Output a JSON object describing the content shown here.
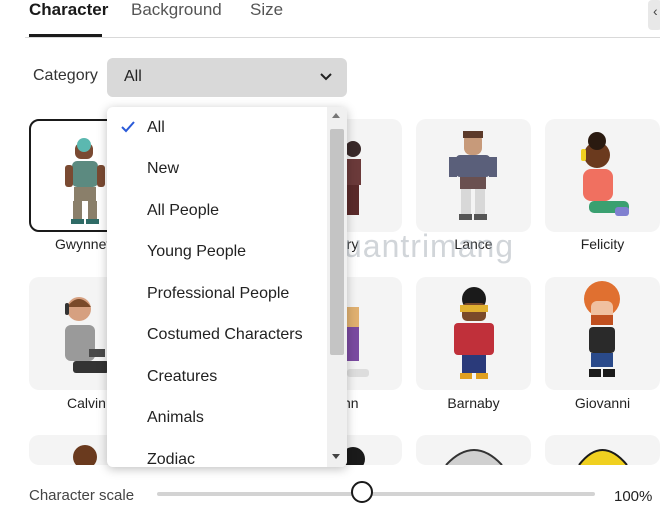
{
  "tabs": [
    {
      "label": "Character",
      "active": true
    },
    {
      "label": "Background",
      "active": false
    },
    {
      "label": "Size",
      "active": false
    }
  ],
  "corner_icon": "chevron-icon",
  "category": {
    "label": "Category",
    "selected": "All",
    "dropdown_open": true,
    "options": [
      "All",
      "New",
      "All People",
      "Young People",
      "Professional People",
      "Costumed Characters",
      "Creatures",
      "Animals",
      "Zodiac"
    ]
  },
  "characters": [
    {
      "name": "Gwynnet",
      "selected": true
    },
    {
      "name": "ory",
      "selected": false
    },
    {
      "name": "Lance",
      "selected": false
    },
    {
      "name": "Felicity",
      "selected": false
    },
    {
      "name": "Calvin",
      "selected": false
    },
    {
      "name": "nn",
      "selected": false
    },
    {
      "name": "Barnaby",
      "selected": false
    },
    {
      "name": "Giovanni",
      "selected": false
    }
  ],
  "scale": {
    "label": "Character scale",
    "value": "100%",
    "slider_fraction": 0.47
  },
  "watermark": "uantrimang",
  "colors": {
    "accent": "#1a1a1a",
    "select_bg": "#d9d9d9",
    "card_bg": "#f4f4f4"
  }
}
